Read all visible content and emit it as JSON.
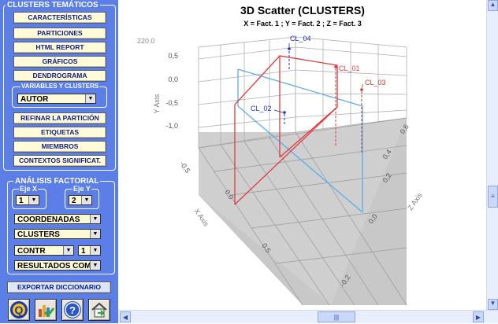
{
  "sidebar": {
    "clusters_tematicos_label": "CLUSTERS TEMÁTICOS",
    "buttons": {
      "caracteristicas": "CARACTERÍSTICAS",
      "particiones": "PARTICIONES",
      "html_report": "HTML REPORT",
      "graficos": "GRÁFICOS",
      "dendrograma": "DENDROGRAMA",
      "refinar": "REFINAR LA PARTICIÓN",
      "etiquetas": "ETIQUETAS",
      "miembros": "MIEMBROS",
      "contextos": "CONTEXTOS SIGNIFICAT.",
      "exportar": "EXPORTAR DICCIONARIO"
    },
    "variables_label": "VARIABLES Y CLUSTERS",
    "variable_select": "AUTOR",
    "analisis_label": "ANÁLISIS FACTORIAL",
    "eje_x_label": "Eje X",
    "eje_x_value": "1",
    "eje_y_label": "Eje Y",
    "eje_y_value": "2",
    "coordenadas_select": "COORDENADAS",
    "clusters_select": "CLUSTERS",
    "contr_select": "CONTR",
    "contr_num_select": "1",
    "resultados_select": "RESULTADOS COMI",
    "icons": [
      "q-logo-icon",
      "chart-check-icon",
      "help-icon",
      "home-icon"
    ]
  },
  "chart": {
    "title": "3D Scatter (CLUSTERS)",
    "subtitle": "X = Fact. 1 ; Y = Fact. 2 ; Z = Fact. 3",
    "top_value": "220.0",
    "y_axis_label": "Y Axis",
    "x_axis_label": "X Axis",
    "z_axis_label": "Z Axis",
    "y_ticks": [
      "0,5",
      "0,0",
      "-0,5",
      "-1,0"
    ],
    "x_ticks": [
      "-0.5",
      "0.0",
      "0.5"
    ],
    "z_ticks": [
      "0,6",
      "0,4",
      "0,2",
      "0,0",
      "-0,2"
    ],
    "cluster_labels": [
      "CL_01",
      "CL_02",
      "CL_03",
      "CL_04"
    ],
    "colors": {
      "cl01": "#e03a3a",
      "cl02": "#1c2fb8",
      "cl03": "#1c2fb8",
      "cl04": "#c0392b",
      "box_red": "#e03a3a",
      "box_blue": "#5aaee8"
    }
  },
  "chart_data": {
    "type": "scatter",
    "title": "3D Scatter (CLUSTERS)",
    "subtitle": "X = Fact. 1 ; Y = Fact. 2 ; Z = Fact. 3",
    "xlabel": "X Axis",
    "ylabel": "Y Axis",
    "zlabel": "Z Axis",
    "y_ticks": [
      "0,5",
      "0,0",
      "-0,5",
      "-1,0"
    ],
    "x_ticks": [
      "-0.5",
      "0.0",
      "0.5"
    ],
    "z_ticks": [
      "0,6",
      "0,4",
      "0,2",
      "0,0",
      "-0,2"
    ],
    "grid": true,
    "points": [
      {
        "name": "CL_01",
        "color": "#e03a3a"
      },
      {
        "name": "CL_02",
        "color": "#1c2fb8"
      },
      {
        "name": "CL_03",
        "color": "#1c2fb8"
      },
      {
        "name": "CL_04",
        "color": "#c0392b"
      }
    ]
  }
}
